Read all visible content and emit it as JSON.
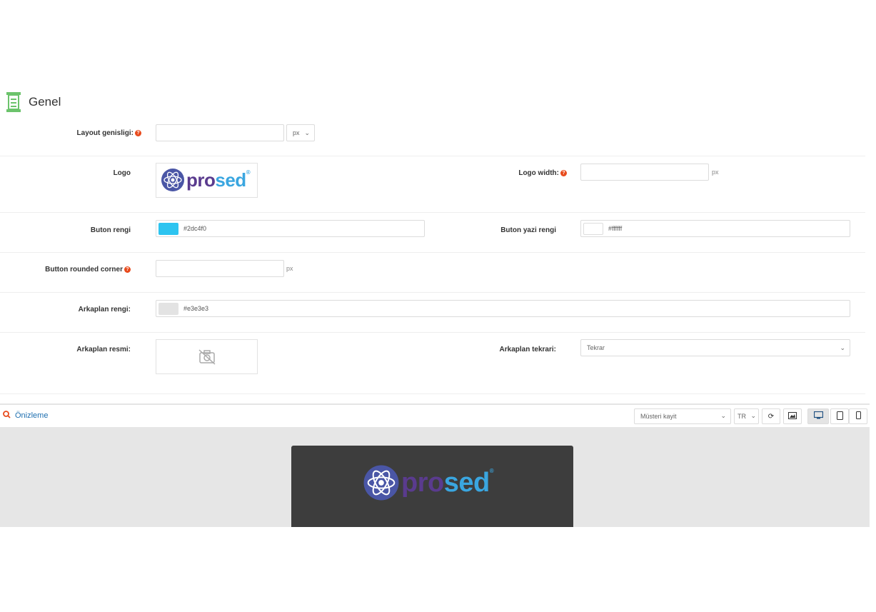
{
  "section": {
    "title": "Genel",
    "icon": "layout-icon"
  },
  "fields": {
    "layout_width": {
      "label": "Layout genisligi:",
      "value": "",
      "unit_select": "px"
    },
    "logo": {
      "label": "Logo",
      "brand_text_a": "pro",
      "brand_text_b": "sed",
      "reg": "®"
    },
    "logo_width": {
      "label": "Logo width:",
      "value": "",
      "unit": "px"
    },
    "button_color": {
      "label": "Buton rengi",
      "value": "#2dc4f0",
      "swatch": "#2dc4f0"
    },
    "button_text_color": {
      "label": "Buton yazi rengi",
      "value": "#ffffff",
      "swatch": "#ffffff"
    },
    "button_rounded": {
      "label": "Button rounded corner",
      "value": "",
      "unit": "px"
    },
    "background_color": {
      "label": "Arkaplan rengi:",
      "value": "#e3e3e3",
      "swatch": "#e3e3e3"
    },
    "background_image": {
      "label": "Arkaplan resmi:",
      "icon": "no-image-icon"
    },
    "background_repeat": {
      "label": "Arkaplan tekrari:",
      "value": "Tekrar"
    }
  },
  "preview": {
    "title": "Önizleme",
    "page_select": "Müsteri kayit",
    "lang_select": "TR",
    "buttons": [
      "refresh-icon",
      "image-icon",
      "desktop-icon",
      "tablet-icon",
      "mobile-icon"
    ],
    "active_device": "desktop"
  },
  "colors": {
    "accent": "#1e6fb0",
    "help": "#e84a1c",
    "card_bg": "#3d3d3d"
  }
}
